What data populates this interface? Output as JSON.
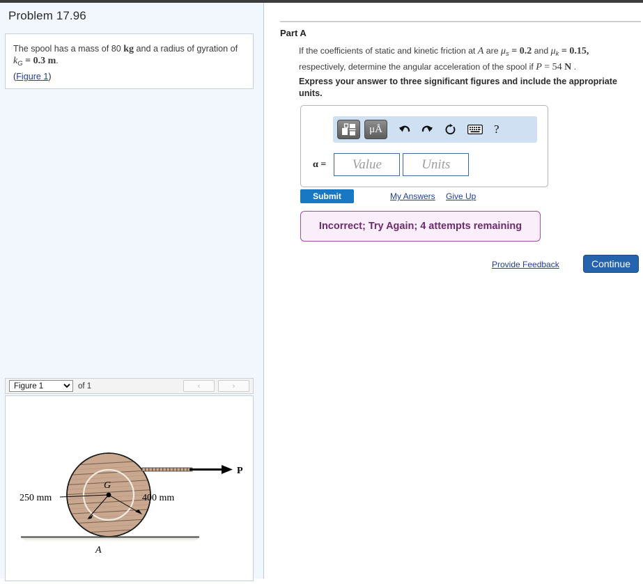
{
  "window": {
    "top_bar_color": "#3c3c3c"
  },
  "left": {
    "problem_title": "Problem 17.96",
    "statement": {
      "line1_a": "The spool has a mass of 80 ",
      "line1_kg": "kg",
      "line1_b": " and a radius of gyration",
      "line2_pre": "of ",
      "line2_k": "k",
      "line2_sub": "G",
      "line2_eq": " = 0.3 m",
      "line2_end": ".",
      "figure_link_open": "(",
      "figure_link": "Figure 1",
      "figure_link_close": ")"
    },
    "figure_bar": {
      "selected": "Figure 1",
      "options": [
        "Figure 1"
      ],
      "of_label": "of 1",
      "prev_label": "‹",
      "next_label": "›"
    },
    "figure": {
      "label_inner_radius": "250 mm",
      "label_outer_radius": "400 mm",
      "label_center": "G",
      "label_contact": "A",
      "label_force": "P",
      "spool_fill": "#c9a88f",
      "grain_color": "#6f5b4a"
    }
  },
  "right": {
    "part_label": "Part A",
    "question": {
      "t1": "If the coefficients of static and kinetic friction at ",
      "A": "A",
      "t2": " are ",
      "mu_s": "μ",
      "mu_s_sub": "s",
      "mu_s_val": " = 0.2",
      "t3": " and ",
      "mu_k": "μ",
      "mu_k_sub": "k",
      "mu_k_val": " = 0.15,",
      "t4": "respectively, determine the angular acceleration of the spool if ",
      "P": "P",
      "P_val": " = 54 ",
      "N": "N",
      "t5": " ."
    },
    "express": "Express your answer to three significant figures and include the appropriate units.",
    "toolbar": {
      "template_icon": "math-template-icon",
      "units_icon": "μÅ",
      "undo_icon": "⮤",
      "redo_icon": "⮥",
      "reset_icon": "↻",
      "keyboard_icon": "keyboard-icon",
      "help_icon": "?"
    },
    "answer": {
      "variable_label": "α =",
      "value_placeholder": "Value",
      "units_placeholder": "Units"
    },
    "actions": {
      "submit": "Submit",
      "my_answers": "My Answers",
      "give_up": "Give Up",
      "provide_feedback": "Provide Feedback",
      "continue": "Continue"
    },
    "feedback": {
      "message": "Incorrect; Try Again; 4 attempts remaining",
      "bg": "#fbeefb",
      "border": "#a24ca2",
      "text_color": "#6d2b6d"
    }
  }
}
